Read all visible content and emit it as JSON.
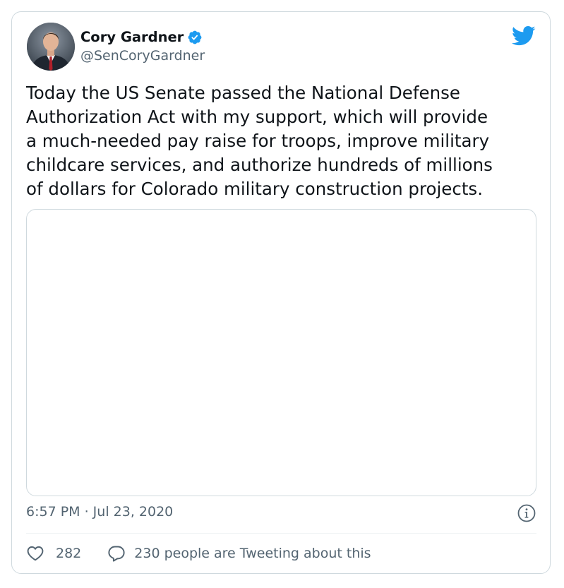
{
  "tweet": {
    "author": {
      "display_name": "Cory Gardner",
      "handle": "@SenCoryGardner",
      "verified": true,
      "verified_color": "#1d9bf0"
    },
    "brand_icon": "twitter-bird-icon",
    "brand_color": "#1d9bf0",
    "text": "Today the US Senate passed the National Defense\nAuthorization Act with my support, which will provide\na much-needed pay raise for troops, improve military\nchildcare services, and authorize hundreds of millions\nof dollars for Colorado military construction projects.",
    "timestamp": "6:57 PM · Jul 23, 2020",
    "likes": "282",
    "conversation": "230 people are Tweeting about this"
  },
  "icons": {
    "like": "heart-icon",
    "reply": "speech-bubble-icon",
    "info": "info-icon"
  }
}
